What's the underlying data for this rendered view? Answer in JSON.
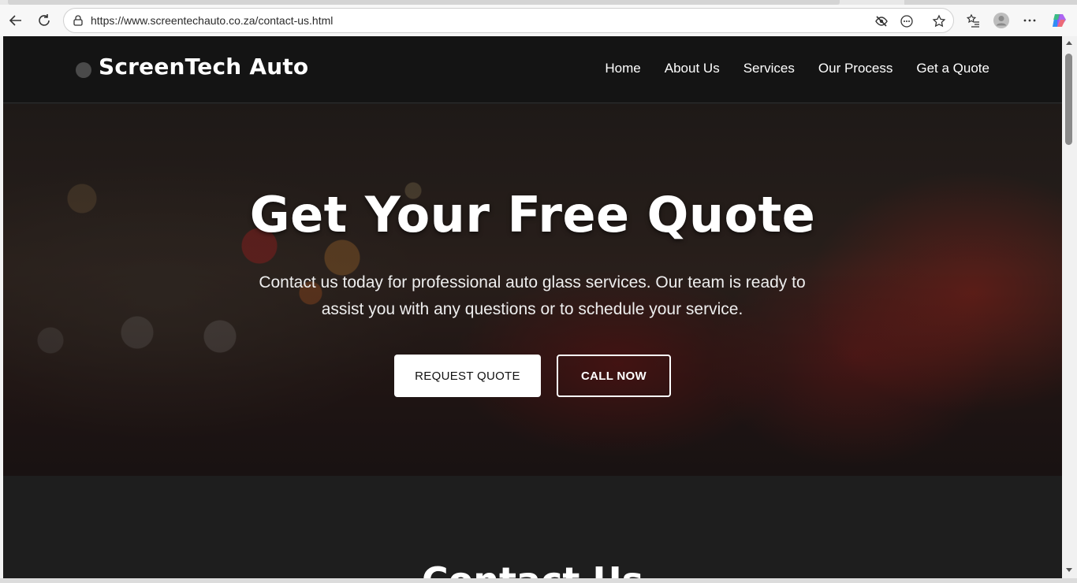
{
  "browser": {
    "url": "https://www.screentechauto.co.za/contact-us.html"
  },
  "site": {
    "logo": "ScreenTech Auto",
    "nav": [
      "Home",
      "About Us",
      "Services",
      "Our Process",
      "Get a Quote"
    ]
  },
  "hero": {
    "title": "Get Your Free Quote",
    "subtitle": "Contact us today for professional auto glass services. Our team is ready to assist you with any questions or to schedule your service.",
    "primary_button": "REQUEST QUOTE",
    "secondary_button": "CALL NOW"
  },
  "contact": {
    "heading": "Contact Us"
  }
}
